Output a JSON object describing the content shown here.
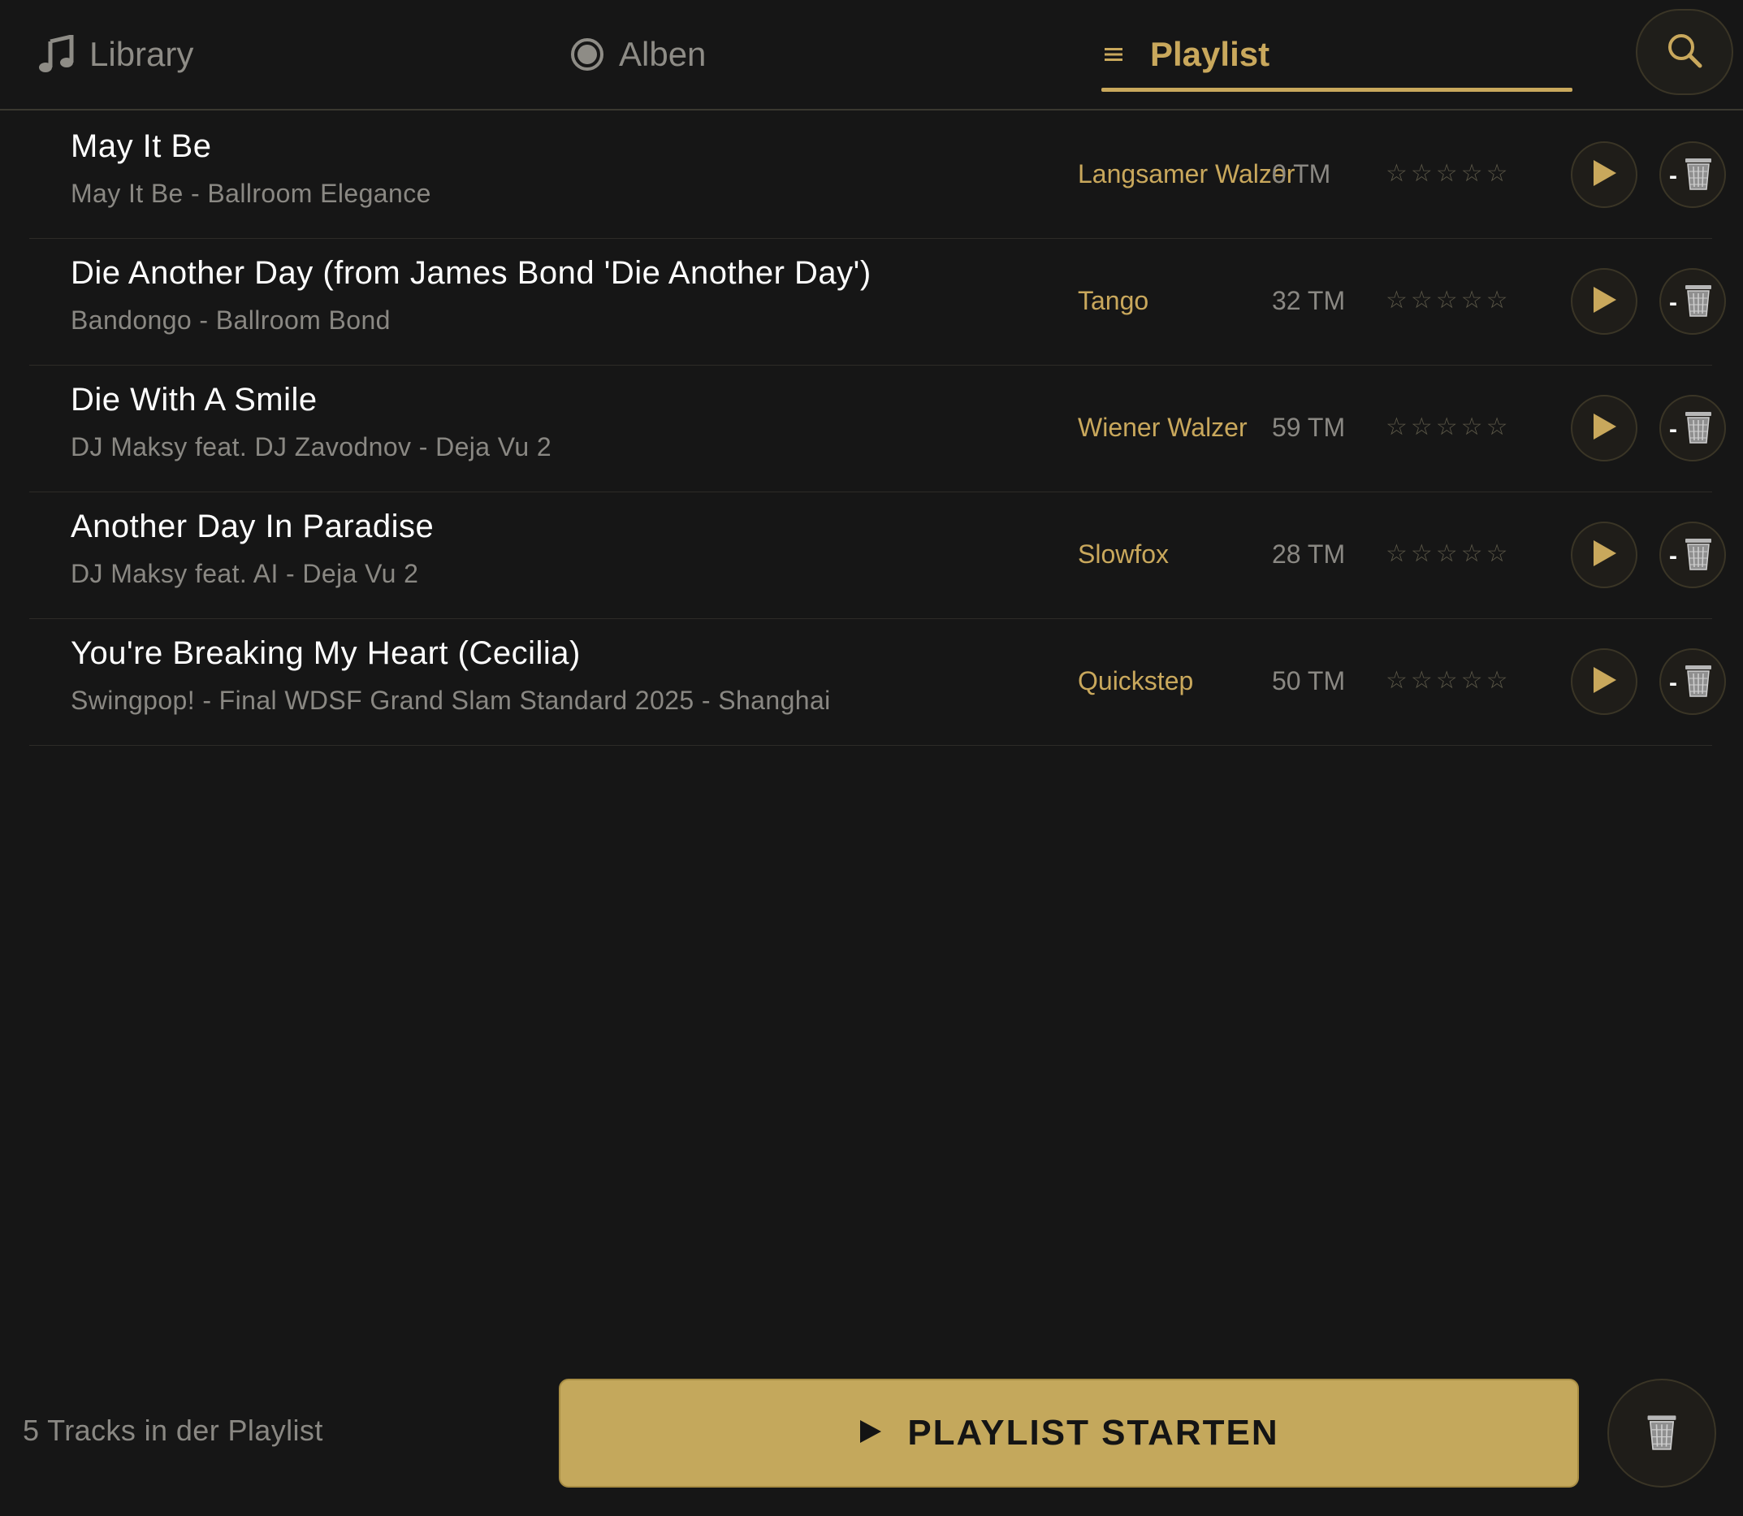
{
  "nav": {
    "tabs": [
      {
        "label": "Library",
        "icon": "music-note-icon",
        "active": false
      },
      {
        "label": "Alben",
        "icon": "disc-icon",
        "active": false
      },
      {
        "label": "Playlist",
        "icon": "list-icon",
        "active": true
      }
    ],
    "search_icon": "search-icon"
  },
  "colors": {
    "background": "#161616",
    "accent": "#c9a85c",
    "muted_text": "#8a8883",
    "button_fill": "#c4a85c"
  },
  "tracks": [
    {
      "title": "May It Be",
      "subtitle": "May It Be - Ballroom Elegance",
      "dance": "Langsamer Walzer",
      "tm": "0 TM",
      "stars": "☆☆☆☆☆",
      "rating": 0
    },
    {
      "title": "Die Another Day (from James Bond 'Die Another Day')",
      "subtitle": "Bandongo - Ballroom Bond",
      "dance": "Tango",
      "tm": "32 TM",
      "stars": "☆☆☆☆☆",
      "rating": 0
    },
    {
      "title": "Die With A Smile",
      "subtitle": "DJ Maksy feat. DJ Zavodnov - Deja Vu 2",
      "dance": "Wiener Walzer",
      "tm": "59 TM",
      "stars": "☆☆☆☆☆",
      "rating": 0
    },
    {
      "title": "Another Day In Paradise",
      "subtitle": "DJ Maksy feat. AI - Deja Vu 2",
      "dance": "Slowfox",
      "tm": "28 TM",
      "stars": "☆☆☆☆☆",
      "rating": 0
    },
    {
      "title": "You're Breaking My Heart (Cecilia)",
      "subtitle": "Swingpop! - Final WDSF Grand Slam Standard 2025 - Shanghai",
      "dance": "Quickstep",
      "tm": "50 TM",
      "stars": "☆☆☆☆☆",
      "rating": 0
    }
  ],
  "row_actions": {
    "play_icon": "play-icon",
    "remove_minus": "-",
    "remove_icon": "trash-icon"
  },
  "footer": {
    "count_text": "5 Tracks in der Playlist",
    "start_label": "PLAYLIST STARTEN",
    "start_icon": "play-icon",
    "clear_icon": "trash-icon"
  }
}
